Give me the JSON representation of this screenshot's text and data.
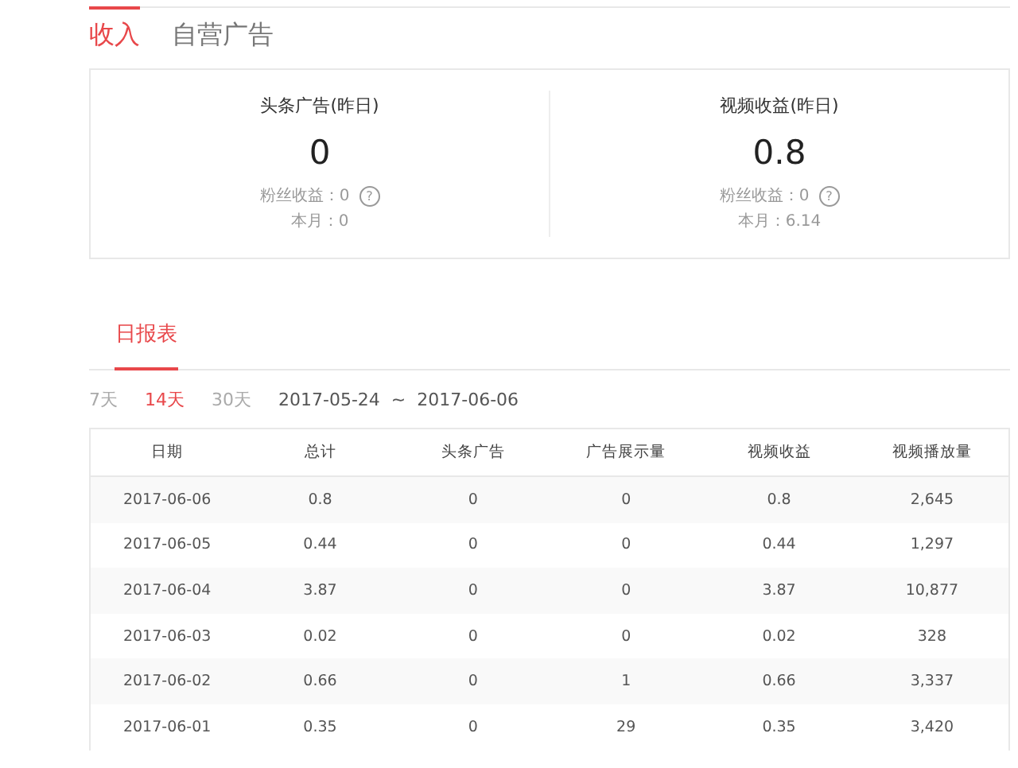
{
  "top_tabs": [
    {
      "label": "收入",
      "selected": true
    },
    {
      "label": "自营广告",
      "selected": false
    }
  ],
  "summary_cards": [
    {
      "title": "头条广告(昨日)",
      "value": "0",
      "fans_income": "粉丝收益：0",
      "help": "?",
      "month": "本月：0"
    },
    {
      "title": "视频收益(昨日)",
      "value": "0.8",
      "fans_income": "粉丝收益：0",
      "help": "?",
      "month": "本月：6.14"
    }
  ],
  "report_tabs": [
    {
      "label": "日报表",
      "selected": true
    }
  ],
  "ranges": [
    {
      "label": "7天",
      "selected": false
    },
    {
      "label": "14天",
      "selected": true
    },
    {
      "label": "30天",
      "selected": false
    }
  ],
  "date_range": "2017-05-24  ~  2017-06-06",
  "table": {
    "columns": [
      "日期",
      "总计",
      "头条广告",
      "广告展示量",
      "视频收益",
      "视频播放量"
    ],
    "rows": [
      [
        "2017-06-06",
        "0.8",
        "0",
        "0",
        "0.8",
        "2,645"
      ],
      [
        "2017-06-05",
        "0.44",
        "0",
        "0",
        "0.44",
        "1,297"
      ],
      [
        "2017-06-04",
        "3.87",
        "0",
        "0",
        "3.87",
        "10,877"
      ],
      [
        "2017-06-03",
        "0.02",
        "0",
        "0",
        "0.02",
        "328"
      ],
      [
        "2017-06-02",
        "0.66",
        "0",
        "1",
        "0.66",
        "3,337"
      ],
      [
        "2017-06-01",
        "0.35",
        "0",
        "29",
        "0.35",
        "3,420"
      ]
    ]
  }
}
